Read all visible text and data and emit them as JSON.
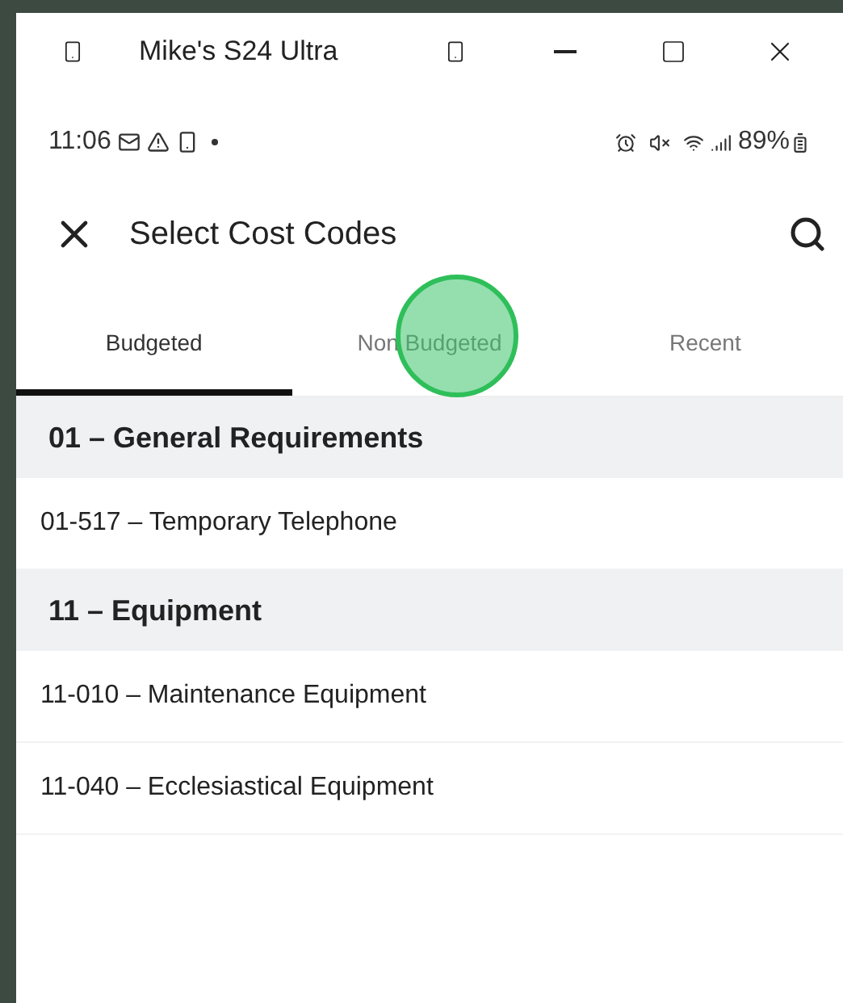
{
  "window": {
    "title": "Mike's S24 Ultra"
  },
  "status_bar": {
    "time": "11:06",
    "battery": "89%"
  },
  "header": {
    "title": "Select Cost Codes"
  },
  "tabs": [
    {
      "label": "Budgeted",
      "selected": true
    },
    {
      "label": "Non Budgeted",
      "selected": false
    },
    {
      "label": "Recent",
      "selected": false
    }
  ],
  "list": [
    {
      "kind": "group",
      "text": "01 – General Requirements"
    },
    {
      "kind": "item",
      "text": "01-517 – Temporary Telephone"
    },
    {
      "kind": "group",
      "text": "11 – Equipment"
    },
    {
      "kind": "item",
      "text": "11-010 – Maintenance Equipment"
    },
    {
      "kind": "item",
      "text": "11-040 – Ecclesiastical Equipment"
    }
  ]
}
